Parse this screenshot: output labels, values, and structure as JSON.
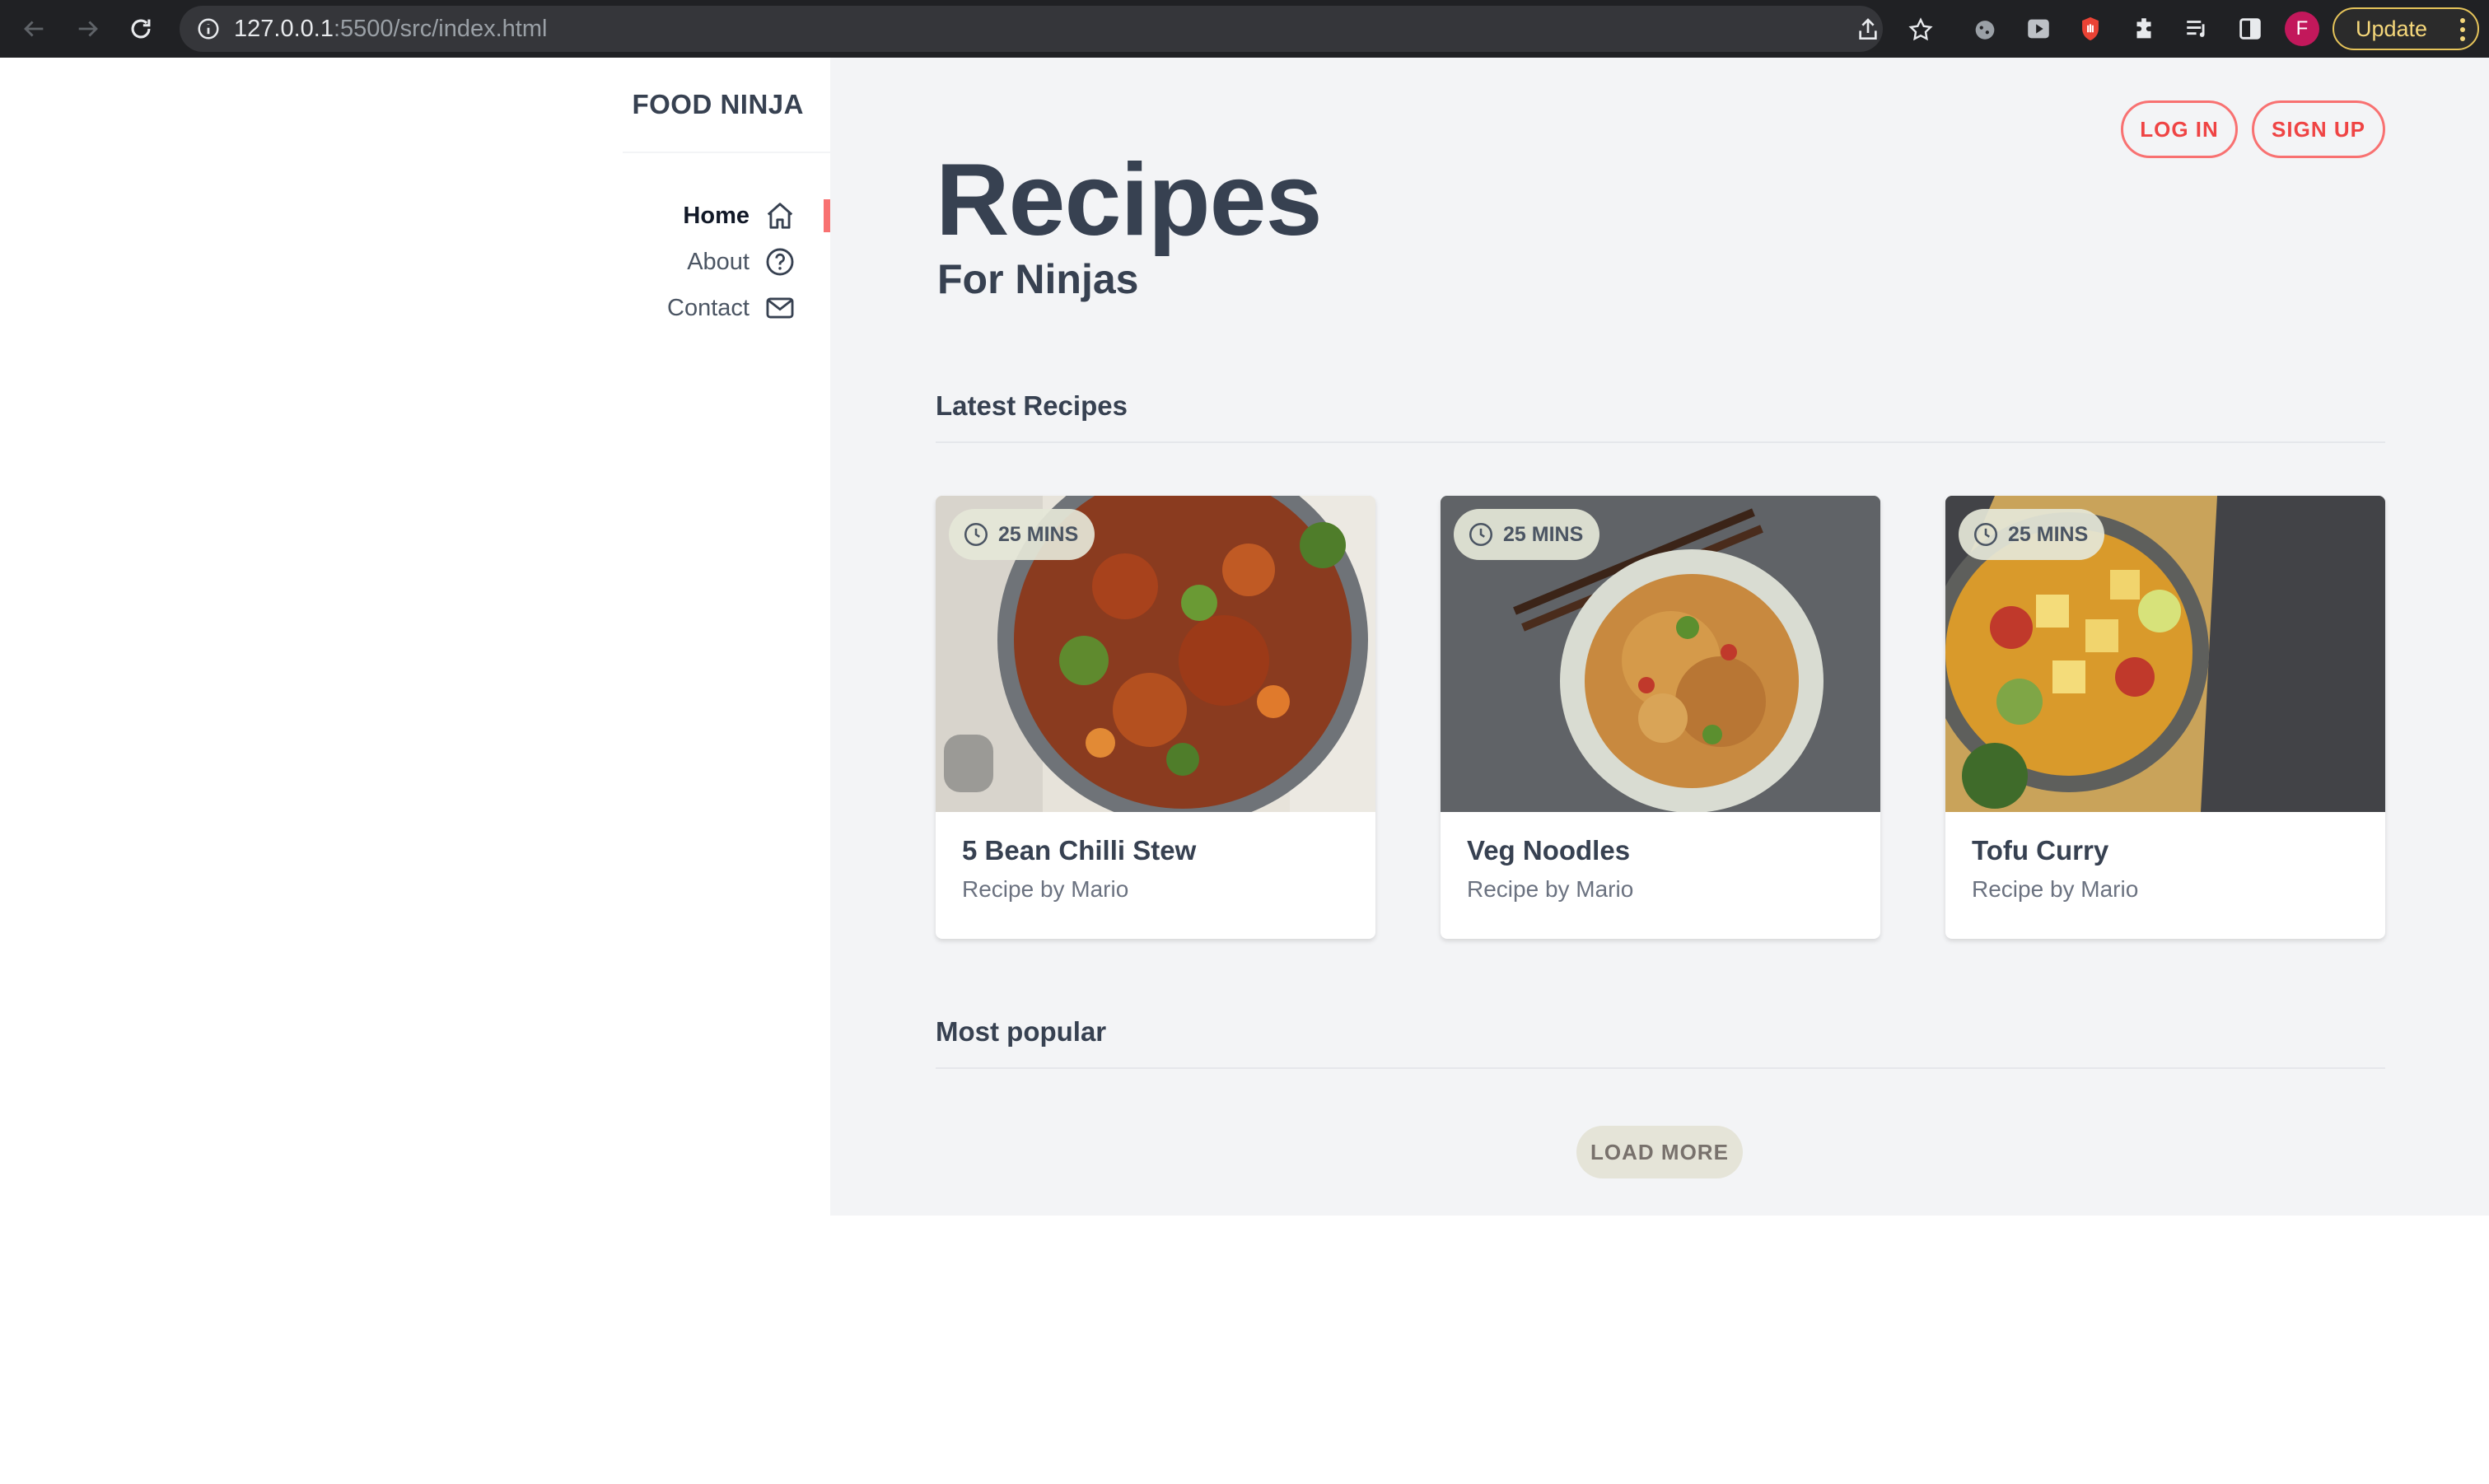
{
  "browser": {
    "url_host": "127.0.0.1",
    "url_rest": ":5500/src/index.html",
    "avatar_letter": "F",
    "update_label": "Update"
  },
  "sidebar": {
    "brand": "FOOD NINJA",
    "items": [
      {
        "label": "Home",
        "icon": "home-icon",
        "active": true
      },
      {
        "label": "About",
        "icon": "help-circle-icon",
        "active": false
      },
      {
        "label": "Contact",
        "icon": "mail-icon",
        "active": false
      }
    ],
    "accent": "#f87171"
  },
  "header": {
    "login_label": "LOG IN",
    "signup_label": "SIGN UP",
    "title": "Recipes",
    "subtitle": "For Ninjas"
  },
  "latest": {
    "heading": "Latest Recipes",
    "cards": [
      {
        "time": "25 MINS",
        "title": "5 Bean Chilli Stew",
        "author": "Recipe by Mario"
      },
      {
        "time": "25 MINS",
        "title": "Veg Noodles",
        "author": "Recipe by Mario"
      },
      {
        "time": "25 MINS",
        "title": "Tofu Curry",
        "author": "Recipe by Mario"
      }
    ]
  },
  "popular": {
    "heading": "Most popular",
    "load_more_label": "LOAD MORE"
  }
}
